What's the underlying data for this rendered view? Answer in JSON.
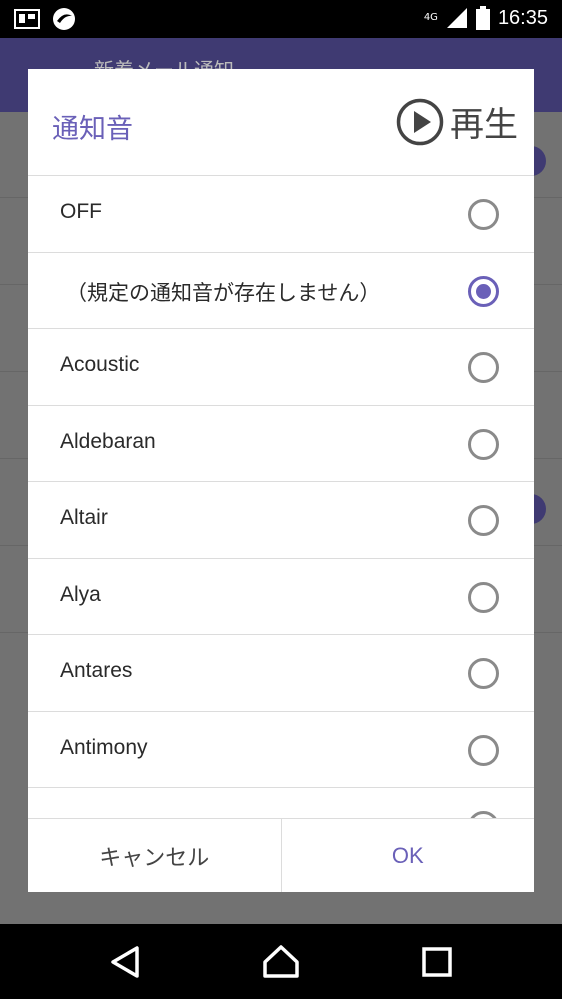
{
  "status_bar": {
    "left_icons": [
      "carrier-icon",
      "trend-micro-icon"
    ],
    "network": "4G",
    "time": "16:35"
  },
  "background_app": {
    "title": "新着メール通知"
  },
  "dialog": {
    "title": "通知音",
    "play_label": "再生",
    "options": [
      {
        "label": "OFF",
        "selected": false
      },
      {
        "label": "（規定の通知音が存在しません）",
        "selected": true
      },
      {
        "label": "Acoustic",
        "selected": false
      },
      {
        "label": "Aldebaran",
        "selected": false
      },
      {
        "label": "Altair",
        "selected": false
      },
      {
        "label": "Alya",
        "selected": false
      },
      {
        "label": "Antares",
        "selected": false
      },
      {
        "label": "Antimony",
        "selected": false
      }
    ],
    "cancel_label": "キャンセル",
    "ok_label": "OK"
  },
  "colors": {
    "accent": "#6a60b8",
    "app_bar": "#3f3a72"
  }
}
